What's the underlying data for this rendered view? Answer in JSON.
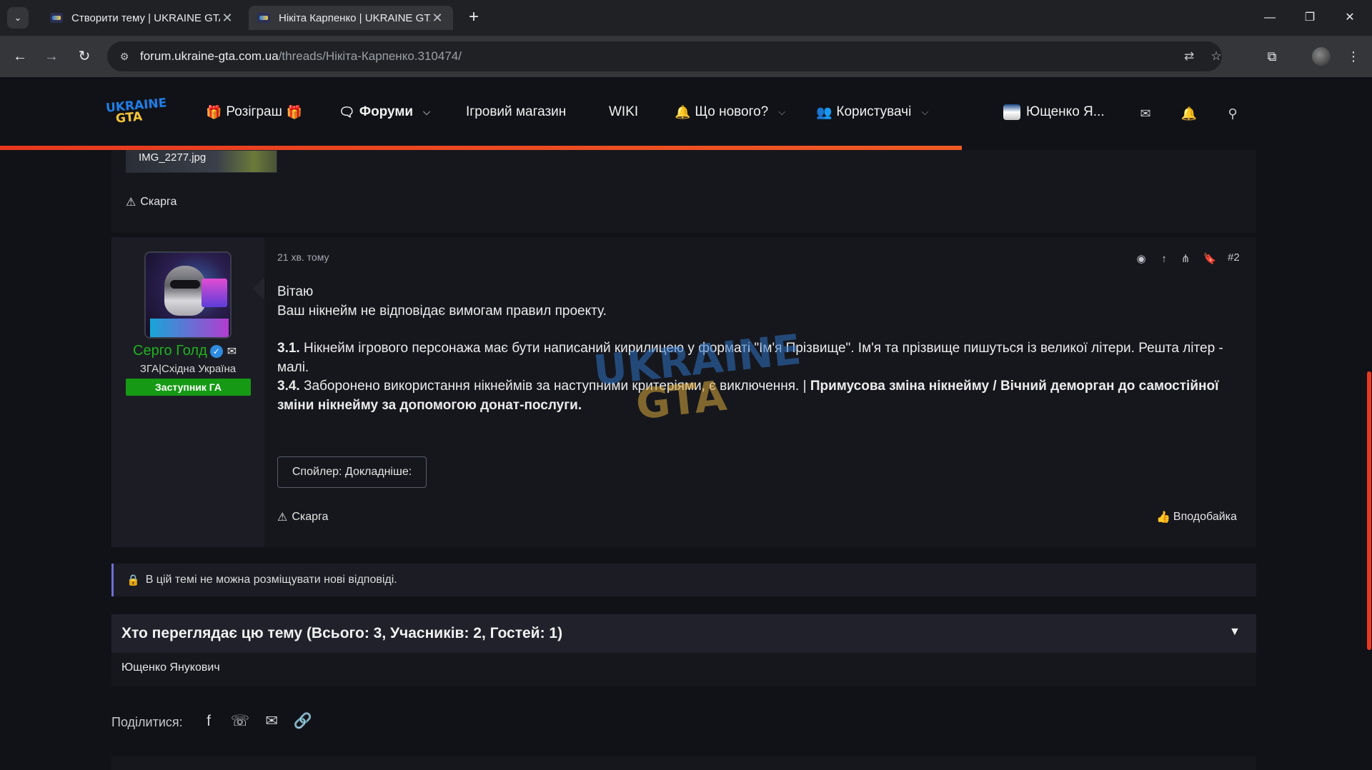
{
  "browser": {
    "tabs": [
      {
        "title": "Створити тему | UKRAINE GTA",
        "close": "✕"
      },
      {
        "title": "Нікіта Карпенко | UKRAINE GTA",
        "close": "✕"
      }
    ],
    "new_tab": "+",
    "url_host": "forum.ukraine-gta.com.ua",
    "url_path": "/threads/Нікіта-Карпенко.310474/"
  },
  "site": {
    "logo_top": "UKRAINE",
    "logo_bottom": "GTA",
    "nav": {
      "giveaway": "Розіграш",
      "forums": "Форуми",
      "shop": "Ігровий магазин",
      "wiki": "WIKI",
      "whats_new": "Що нового?",
      "users": "Користувачі"
    },
    "current_user": "Ющенко Я...",
    "accent_color": "#e8381f"
  },
  "prev_post": {
    "attachment": "IMG_2277.jpg",
    "report": "Скарга"
  },
  "post": {
    "time": "21 хв. тому",
    "number": "#2",
    "author": {
      "name": "Серго Голд",
      "title": "ЗГА|Східна Україна",
      "banner": "Заступник ГА"
    },
    "body": {
      "greeting": "Вітаю",
      "line1": "Ваш нікнейм не відповідає вимогам правил проекту.",
      "rule1_num": "3.1.",
      "rule1_text": " Нікнейм ігрового персонажа має бути написаний кирилицею у форматі \"Ім'я Прізвище\". Ім'я та прізвище пишуться із великої літери. Решта літер - малі.",
      "rule2_num": "3.4.",
      "rule2_text": " Заборонено використання нікнеймів за наступними критеріями, є виключення. | ",
      "rule2_penalty": "Примусова зміна нікнейму / Вічний деморган до самостійної зміни нікнейму за допомогою донат-послуги."
    },
    "spoiler": "Спойлер: Докладніше:",
    "report": "Скарга",
    "like": "Вподобайка"
  },
  "locked_notice": "В цій темі не можна розміщувати нові відповіді.",
  "viewers": {
    "title": "Хто переглядає цю тему (Всього: 3, Учасників: 2, Гостей: 1)",
    "list": "Ющенко Янукович"
  },
  "share": {
    "label": "Поділитися:"
  }
}
